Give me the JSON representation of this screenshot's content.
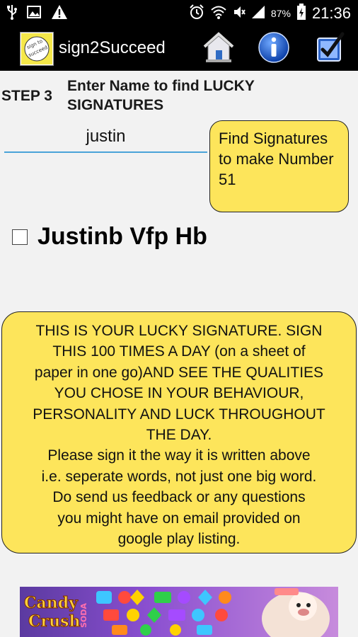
{
  "status_bar": {
    "battery_percent": "87%",
    "time": "21:36",
    "icons": [
      "usb-icon",
      "image-icon",
      "warning-icon",
      "alarm-icon",
      "wifi-icon",
      "mute-icon",
      "signal-icon",
      "battery-icon"
    ]
  },
  "action_bar": {
    "app_title": "sign2Succeed",
    "logo_text": "sign to succeed",
    "icons": [
      "home-icon",
      "info-icon",
      "checklist-icon"
    ]
  },
  "step": {
    "label": "STEP 3",
    "instruction": "Enter Name to find LUCKY SIGNATURES"
  },
  "name_input": {
    "value": "justin"
  },
  "find_button": {
    "label": "Find Signatures to make Number 51"
  },
  "signature": {
    "text": "Justinb Vfp Hb",
    "checked": false
  },
  "info": {
    "lines": [
      "THIS IS YOUR LUCKY SIGNATURE. SIGN",
      "THIS 100 TIMES A DAY (on a sheet of",
      "paper in one go)AND SEE THE QUALITIES",
      "YOU CHOSE IN YOUR BEHAVIOUR,",
      "PERSONALITY AND LUCK THROUGHOUT",
      "THE DAY.",
      "Please sign it the way it is written above",
      "i.e. seperate words, not just one big word.",
      "Do send us feedback or any questions",
      "you might have on email provided on",
      "google play listing."
    ]
  },
  "ad": {
    "brand_line1": "Candy",
    "brand_line2": "Crush",
    "brand_line3": "SODA"
  },
  "colors": {
    "button_yellow": "#fde55b",
    "input_underline": "#4aa3d8",
    "background": "#f2f2f2",
    "bar": "#000000"
  }
}
